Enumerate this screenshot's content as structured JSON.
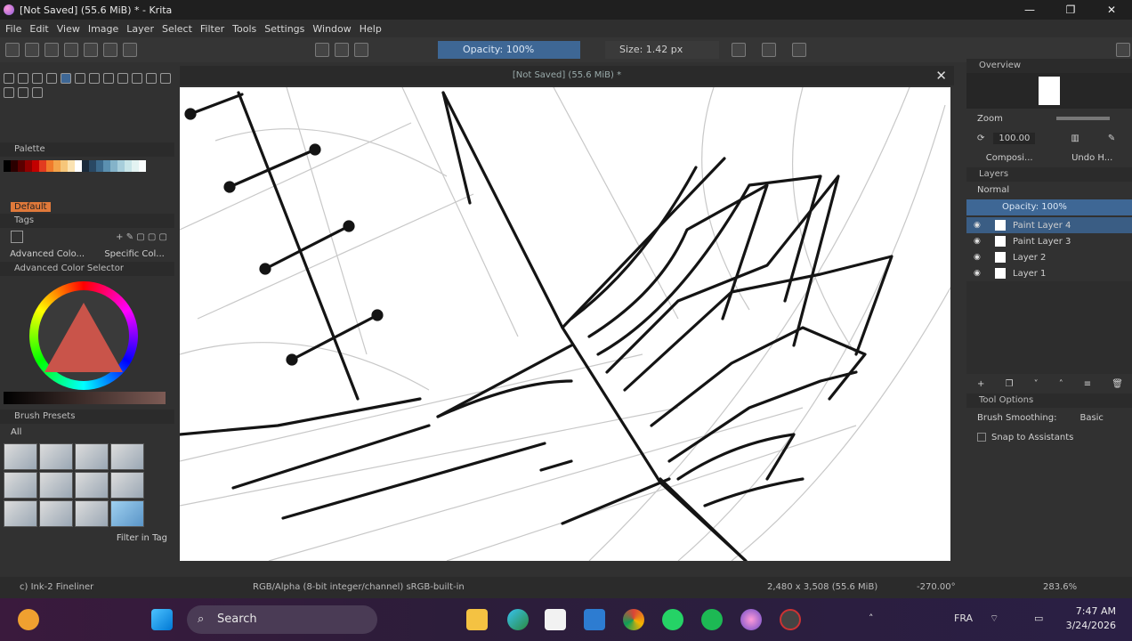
{
  "window": {
    "title": "[Not Saved] (55.6 MiB) * - Krita",
    "min": "—",
    "max": "❐",
    "close": "✕"
  },
  "menu": [
    "File",
    "Edit",
    "View",
    "Image",
    "Layer",
    "Select",
    "Filter",
    "Tools",
    "Settings",
    "Window",
    "Help"
  ],
  "toolbar": {
    "opacity": "Opacity: 100%",
    "size": "Size: 1.42 px"
  },
  "document": {
    "tab_title": "[Not Saved] (55.6 MiB) *",
    "close": "✕"
  },
  "left": {
    "palette_title": "Palette",
    "palette_name": "Default",
    "tags_title": "Tags",
    "advanced_colors_tab": "Advanced Colo...",
    "specific_colors_tab": "Specific Col...",
    "color_selector_title": "Advanced Color Selector",
    "brush_presets_title": "Brush Presets",
    "brush_tag": "All",
    "filter_in_tag": "Filter in Tag",
    "palette_colors": [
      "#000000",
      "#2b0000",
      "#5a0000",
      "#8f0000",
      "#c20000",
      "#e23b1f",
      "#f07a2a",
      "#f3a34a",
      "#f6c67a",
      "#fbe3b2",
      "#ffffff",
      "#1a2a3a",
      "#294863",
      "#3c6a8c",
      "#5b90b0",
      "#84b3c9",
      "#a7cedb",
      "#c8e5e8",
      "#e3f3f2",
      "#f8fcfc"
    ]
  },
  "right": {
    "overview_title": "Overview",
    "zoom_label": "Zoom",
    "angle_value": "100.00",
    "compositions_tab": "Composi...",
    "undo_tab": "Undo H...",
    "layers_title": "Layers",
    "blend_mode": "Normal",
    "layer_opacity": "Opacity: 100%",
    "layers": [
      {
        "name": "Paint Layer 4",
        "selected": true
      },
      {
        "name": "Paint Layer 3",
        "selected": false
      },
      {
        "name": "Layer 2",
        "selected": false
      },
      {
        "name": "Layer 1",
        "selected": false
      }
    ],
    "tool_options_title": "Tool Options",
    "smoothing_label": "Brush Smoothing:",
    "smoothing_value": "Basic",
    "snap_label": "Snap to Assistants"
  },
  "status": {
    "brush": "c) Ink-2 Fineliner",
    "color_model": "RGB/Alpha (8-bit integer/channel)  sRGB-built-in",
    "dims": "2,480 x 3,508 (55.6 MiB)",
    "rotation": "-270.00°",
    "zoom": "283.6%"
  },
  "taskbar": {
    "search": "Search",
    "lang": "FRA",
    "time": "7:47 AM",
    "date": "3/24/2026"
  }
}
